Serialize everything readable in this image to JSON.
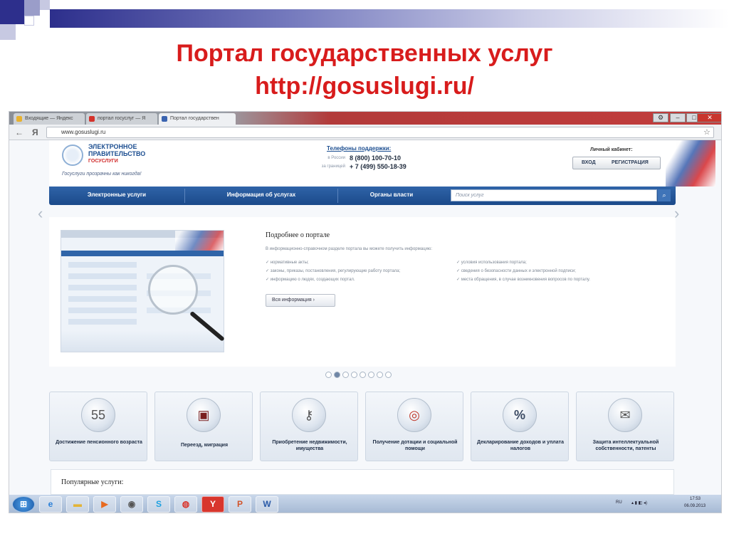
{
  "slide": {
    "title_line1": "Портал государственных услуг",
    "title_line2": "http://gosuslugi.ru/"
  },
  "browser": {
    "tabs": [
      {
        "label": "Входящие — Яндекс",
        "favicon_color": "#e8b12e"
      },
      {
        "label": "портал госуслуг — Я",
        "favicon_color": "#d4322b"
      },
      {
        "label": "Портал государствен",
        "favicon_color": "#3b64b0"
      }
    ],
    "url": "www.gosuslugi.ru",
    "nav_back": "←",
    "nav_ya": "Я",
    "window_buttons": [
      "⚙",
      "–",
      "□",
      "✕"
    ]
  },
  "portal": {
    "logo_title": "ЭЛЕКТРОННОЕ ПРАВИТЕЛЬСТВО",
    "logo_subtitle": "ГОСУСЛУГИ",
    "slogan": "Госуслуги прозрачны как никогда!",
    "support": {
      "title": "Телефоны поддержки:",
      "russia_label": "в России",
      "russia_number": "8 (800) 100-70-10",
      "abroad_label": "за границей",
      "abroad_number": "+ 7 (499) 550-18-39"
    },
    "cabinet": {
      "title": "Личный кабинет:",
      "login": "ВХОД",
      "register": "РЕГИСТРАЦИЯ"
    },
    "menu": [
      "Электронные услуги",
      "Информация об услугах",
      "Органы власти"
    ],
    "search_placeholder": "Поиск услуг",
    "about": {
      "title": "Подробнее о портале",
      "intro": "В информационно-справочном разделе портала вы можете получить информацию:",
      "left_items": [
        "нормативные акты;",
        "законы, приказы, постановления, регулирующие работу портала;",
        "информацию о людях, создающих портал."
      ],
      "right_items": [
        "условия использования портала;",
        "сведения о безопасности данных и электронной подписи;",
        "места обращения, в случае возникновения вопросов по порталу."
      ],
      "all_info": "Вся информация"
    },
    "categories": [
      {
        "label": "Достижение пенсионного возраста",
        "icon": "calendar-55-icon",
        "glyph": "55"
      },
      {
        "label": "Переезд, миграция",
        "icon": "passport-icon",
        "glyph": "▣"
      },
      {
        "label": "Приобретение недвижимости, имущества",
        "icon": "keys-icon",
        "glyph": "⚷"
      },
      {
        "label": "Получение дотации и социальной помощи",
        "icon": "lifebuoy-icon",
        "glyph": "◎"
      },
      {
        "label": "Декларирование доходов и уплата налогов",
        "icon": "percent-icon",
        "glyph": "%"
      },
      {
        "label": "Защита интеллектуальной собственности, патенты",
        "icon": "certificate-icon",
        "glyph": "✉"
      }
    ],
    "popular_title": "Популярные услуги:"
  },
  "taskbar": {
    "lang": "RU",
    "time": "17:53",
    "date": "06.09.2013",
    "apps": [
      "start-icon",
      "ie-icon",
      "explorer-icon",
      "media-icon",
      "disk-icon",
      "skype-icon",
      "chrome-icon",
      "yandex-icon",
      "powerpoint-icon",
      "word-icon"
    ]
  }
}
